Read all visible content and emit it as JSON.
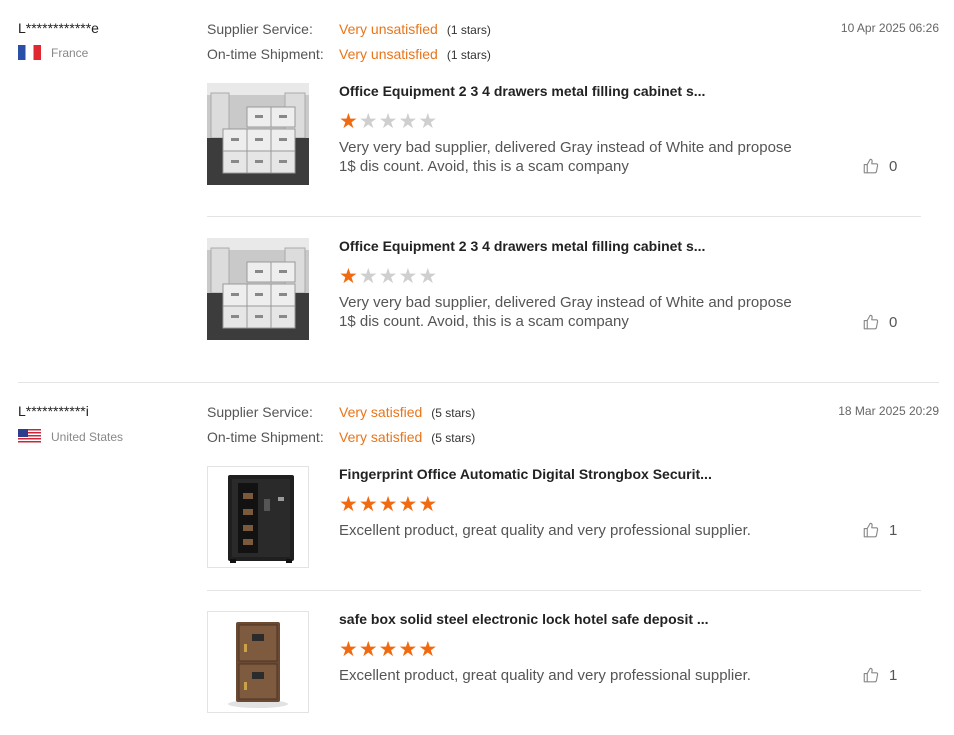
{
  "reviews": [
    {
      "user": "L************e",
      "country": "France",
      "flag_icon": "france-flag-icon",
      "date": "10 Apr 2025 06:26",
      "ratings": [
        {
          "label": "Supplier Service:",
          "value": "Very unsatisfied",
          "stars_text": "(1 stars)"
        },
        {
          "label": "On-time Shipment:",
          "value": "Very unsatisfied",
          "stars_text": "(1 stars)"
        }
      ],
      "products": [
        {
          "title": "Office Equipment 2 3 4 drawers metal filling cabinet s...",
          "rating": 1,
          "comment": "Very very bad supplier, delivered Gray instead of White and propose 1$ dis count. Avoid, this is a scam company",
          "likes": "0"
        },
        {
          "title": "Office Equipment 2 3 4 drawers metal filling cabinet s...",
          "rating": 1,
          "comment": "Very very bad supplier, delivered Gray instead of White and propose 1$ dis count. Avoid, this is a scam company",
          "likes": "0"
        }
      ]
    },
    {
      "user": "L***********i",
      "country": "United States",
      "flag_icon": "us-flag-icon",
      "date": "18 Mar 2025 20:29",
      "ratings": [
        {
          "label": "Supplier Service:",
          "value": "Very satisfied",
          "stars_text": "(5 stars)"
        },
        {
          "label": "On-time Shipment:",
          "value": "Very satisfied",
          "stars_text": "(5 stars)"
        }
      ],
      "products": [
        {
          "title": "Fingerprint Office Automatic Digital Strongbox Securit...",
          "rating": 5,
          "comment": "Excellent product, great quality and very professional supplier.",
          "likes": "1"
        },
        {
          "title": "safe box solid steel electronic lock hotel safe deposit ...",
          "rating": 5,
          "comment": "Excellent product, great quality and very professional supplier.",
          "likes": "1"
        }
      ]
    }
  ],
  "colors": {
    "accent": "#e8751a",
    "star_on": "#f26a10",
    "star_off": "#cfcfcf"
  },
  "max_stars": 5
}
